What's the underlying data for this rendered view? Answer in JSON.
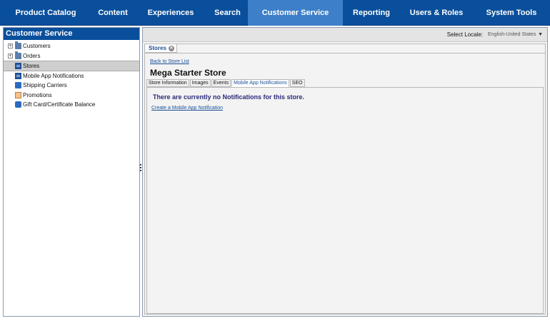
{
  "topnav": {
    "tabs": [
      {
        "label": "Product Catalog",
        "active": false
      },
      {
        "label": "Content",
        "active": false
      },
      {
        "label": "Experiences",
        "active": false
      },
      {
        "label": "Search",
        "active": false
      },
      {
        "label": "Customer Service",
        "active": true
      },
      {
        "label": "Reporting",
        "active": false
      },
      {
        "label": "Users & Roles",
        "active": false
      },
      {
        "label": "System Tools",
        "active": false
      }
    ]
  },
  "sidebar": {
    "title": "Customer Service",
    "items": [
      {
        "label": "Customers",
        "icon": "folder-icon",
        "expandable": true,
        "selected": false
      },
      {
        "label": "Orders",
        "icon": "folder-icon",
        "expandable": true,
        "selected": false
      },
      {
        "label": "Stores",
        "icon": "store-icon",
        "expandable": false,
        "selected": true
      },
      {
        "label": "Mobile App Notifications",
        "icon": "store-icon",
        "expandable": false,
        "selected": false
      },
      {
        "label": "Shipping Carriers",
        "icon": "truck-icon",
        "expandable": false,
        "selected": false
      },
      {
        "label": "Promotions",
        "icon": "promotion-icon",
        "expandable": false,
        "selected": false
      },
      {
        "label": "Gift Card/Certificate Balance",
        "icon": "gift-card-icon",
        "expandable": false,
        "selected": false
      }
    ]
  },
  "locale": {
    "label": "Select Locale:",
    "value": "English-United States"
  },
  "doc_tab": {
    "label": "Stores"
  },
  "store": {
    "back_link": "Back to Store List",
    "title": "Mega Starter Store",
    "subtabs": [
      {
        "label": "Store Information",
        "active": false
      },
      {
        "label": "Images",
        "active": false
      },
      {
        "label": "Events",
        "active": false
      },
      {
        "label": "Mobile App Notifications",
        "active": true
      },
      {
        "label": "SEO",
        "active": false
      }
    ],
    "empty_message": "There are currently no Notifications for this store.",
    "create_link": "Create a Mobile App Notification"
  },
  "colors": {
    "nav_bg": "#0a4f9c",
    "nav_active": "#3d7fc8",
    "link": "#1a4f96"
  }
}
